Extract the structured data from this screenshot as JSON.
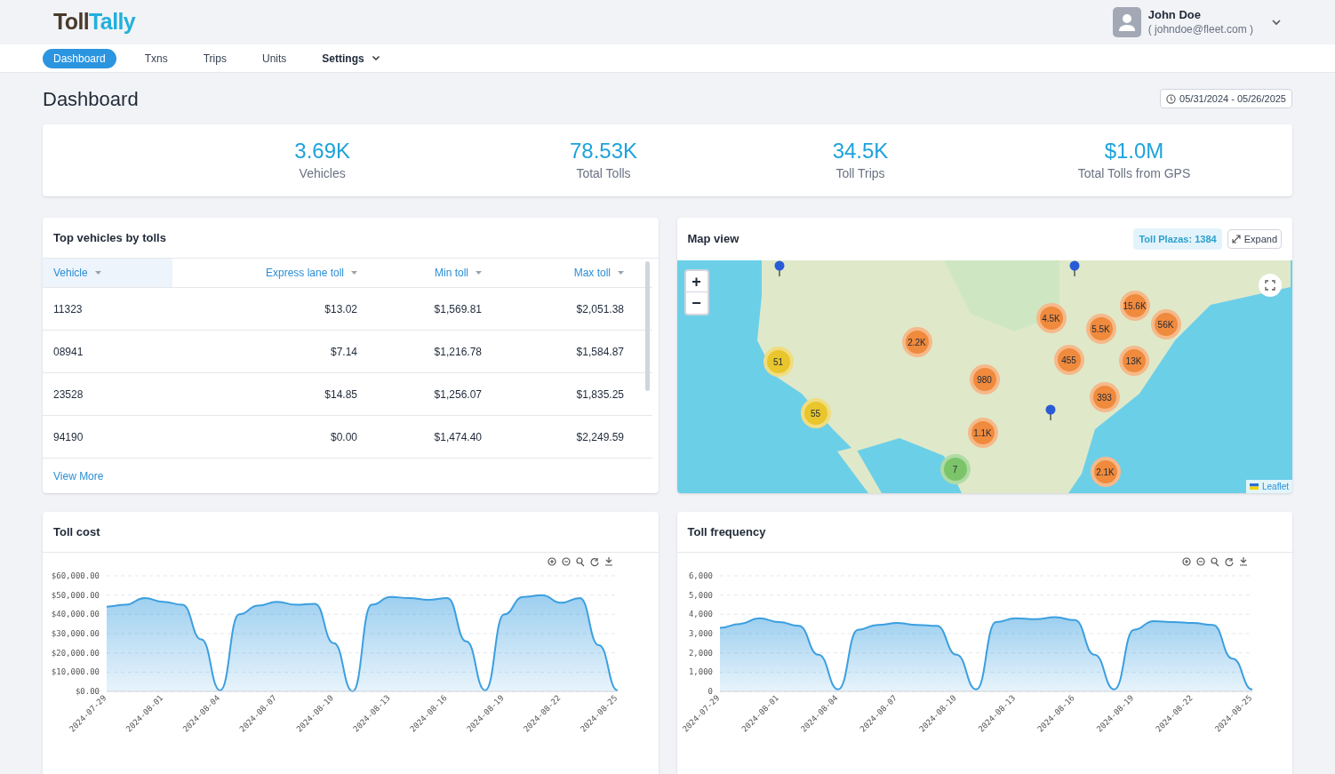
{
  "brand": {
    "prefix": "Toll",
    "name": "Tally"
  },
  "user": {
    "name": "John Doe",
    "email": "( johndoe@fleet.com )"
  },
  "nav": [
    {
      "label": "Dashboard",
      "selected": true,
      "kind": "link"
    },
    {
      "label": "Txns",
      "selected": false,
      "kind": "link"
    },
    {
      "label": "Trips",
      "selected": false,
      "kind": "link"
    },
    {
      "label": "Units",
      "selected": false,
      "kind": "link"
    },
    {
      "label": "Settings",
      "selected": false,
      "kind": "menu"
    }
  ],
  "page_title": "Dashboard",
  "date_range": "05/31/2024 - 05/26/2025",
  "stats": [
    {
      "value": "3.69K",
      "label": "Vehicles"
    },
    {
      "value": "78.53K",
      "label": "Total Tolls"
    },
    {
      "value": "34.5K",
      "label": "Toll Trips"
    },
    {
      "value": "$1.0M",
      "label": "Total Tolls from GPS"
    }
  ],
  "top_vehicles": {
    "title": "Top vehicles by tolls",
    "columns": [
      {
        "label": "Vehicle",
        "selected": true
      },
      {
        "label": "Express lane toll",
        "selected": false
      },
      {
        "label": "Min toll",
        "selected": false
      },
      {
        "label": "Max toll",
        "selected": false
      }
    ],
    "rows": [
      [
        "11323",
        "$13.02",
        "$1,569.81",
        "$2,051.38"
      ],
      [
        "08941",
        "$7.14",
        "$1,216.78",
        "$1,584.87"
      ],
      [
        "23528",
        "$14.85",
        "$1,256.07",
        "$1,835.25"
      ],
      [
        "94190",
        "$0.00",
        "$1,474.40",
        "$2,249.59"
      ]
    ],
    "link": "View More"
  },
  "map": {
    "title": "Map view",
    "badge": "Toll Plazas: 1384",
    "expand": "Expand",
    "zoom_in": "+",
    "zoom_out": "−",
    "attribution": "Leaflet",
    "clusters": [
      {
        "label": "2.2K",
        "color": "#f08a3c"
      },
      {
        "label": "4.5K",
        "color": "#f08a3c"
      },
      {
        "label": "15.6K",
        "color": "#f08a3c"
      },
      {
        "label": "5.5K",
        "color": "#f08a3c"
      },
      {
        "label": "56K",
        "color": "#f08a3c"
      },
      {
        "label": "51",
        "color": "#e8c62c"
      },
      {
        "label": "455",
        "color": "#f08a3c"
      },
      {
        "label": "13K",
        "color": "#f08a3c"
      },
      {
        "label": "980",
        "color": "#f08a3c"
      },
      {
        "label": "393",
        "color": "#f08a3c"
      },
      {
        "label": "55",
        "color": "#e8c62c"
      },
      {
        "label": "1.1K",
        "color": "#f08a3c"
      },
      {
        "label": "7",
        "color": "#7cc46a"
      },
      {
        "label": "2.1K",
        "color": "#f08a3c"
      }
    ]
  },
  "charts": [
    {
      "title": "Toll cost",
      "chart_data": {
        "type": "area",
        "x": [
          "2024-07-29",
          "2024-07-30",
          "2024-07-31",
          "2024-08-01",
          "2024-08-02",
          "2024-08-03",
          "2024-08-04",
          "2024-08-05",
          "2024-08-06",
          "2024-08-07",
          "2024-08-08",
          "2024-08-09",
          "2024-08-10",
          "2024-08-11",
          "2024-08-12",
          "2024-08-13",
          "2024-08-14",
          "2024-08-15",
          "2024-08-16",
          "2024-08-17",
          "2024-08-18",
          "2024-08-19",
          "2024-08-20",
          "2024-08-21",
          "2024-08-22",
          "2024-08-23",
          "2024-08-24",
          "2024-08-25"
        ],
        "xlim": [
          "2024-07-29",
          "2024-08-25"
        ],
        "grid": true,
        "series": [
          {
            "color": "#3b9fe0",
            "values": [
              44000,
              45000,
              48500,
              46500,
              45000,
              27000,
              500,
              40000,
              44500,
              46500,
              45000,
              45500,
              25000,
              0,
              45000,
              49000,
              48500,
              47500,
              48500,
              26000,
              500,
              40000,
              49000,
              50000,
              46000,
              48500,
              24000,
              500
            ]
          }
        ],
        "ylim": [
          0,
          60000
        ],
        "yticks": [
          {
            "value": 0,
            "label": "$0.00"
          },
          {
            "value": 10000,
            "label": "$10,000.00"
          },
          {
            "value": 20000,
            "label": "$20,000.00"
          },
          {
            "value": 30000,
            "label": "$30,000.00"
          },
          {
            "value": 40000,
            "label": "$40,000.00"
          },
          {
            "value": 50000,
            "label": "$50,000.00"
          },
          {
            "value": 60000,
            "label": "$60,000.00"
          }
        ],
        "xticks": [
          "2024-07-29",
          "2024-08-01",
          "2024-08-04",
          "2024-08-07",
          "2024-08-10",
          "2024-08-13",
          "2024-08-16",
          "2024-08-19",
          "2024-08-22",
          "2024-08-25"
        ]
      }
    },
    {
      "title": "Toll frequency",
      "chart_data": {
        "type": "area",
        "x": [
          "2024-07-29",
          "2024-07-30",
          "2024-07-31",
          "2024-08-01",
          "2024-08-02",
          "2024-08-03",
          "2024-08-04",
          "2024-08-05",
          "2024-08-06",
          "2024-08-07",
          "2024-08-08",
          "2024-08-09",
          "2024-08-10",
          "2024-08-11",
          "2024-08-12",
          "2024-08-13",
          "2024-08-14",
          "2024-08-15",
          "2024-08-16",
          "2024-08-17",
          "2024-08-18",
          "2024-08-19",
          "2024-08-20",
          "2024-08-21",
          "2024-08-22",
          "2024-08-23",
          "2024-08-24",
          "2024-08-25"
        ],
        "xlim": [
          "2024-07-29",
          "2024-08-25"
        ],
        "grid": true,
        "series": [
          {
            "color": "#3b9fe0",
            "values": [
              3300,
              3500,
              3800,
              3600,
              3400,
              1900,
              100,
              3200,
              3450,
              3550,
              3450,
              3400,
              1900,
              100,
              3600,
              3800,
              3750,
              3850,
              3700,
              1900,
              100,
              3200,
              3650,
              3600,
              3550,
              3450,
              1700,
              100
            ]
          }
        ],
        "ylim": [
          0,
          6000
        ],
        "yticks": [
          {
            "value": 0,
            "label": "0"
          },
          {
            "value": 1000,
            "label": "1,000"
          },
          {
            "value": 2000,
            "label": "2,000"
          },
          {
            "value": 3000,
            "label": "3,000"
          },
          {
            "value": 4000,
            "label": "4,000"
          },
          {
            "value": 5000,
            "label": "5,000"
          },
          {
            "value": 6000,
            "label": "6,000"
          }
        ],
        "xticks": [
          "2024-07-29",
          "2024-08-01",
          "2024-08-04",
          "2024-08-07",
          "2024-08-10",
          "2024-08-13",
          "2024-08-16",
          "2024-08-19",
          "2024-08-22",
          "2024-08-25"
        ]
      }
    }
  ]
}
